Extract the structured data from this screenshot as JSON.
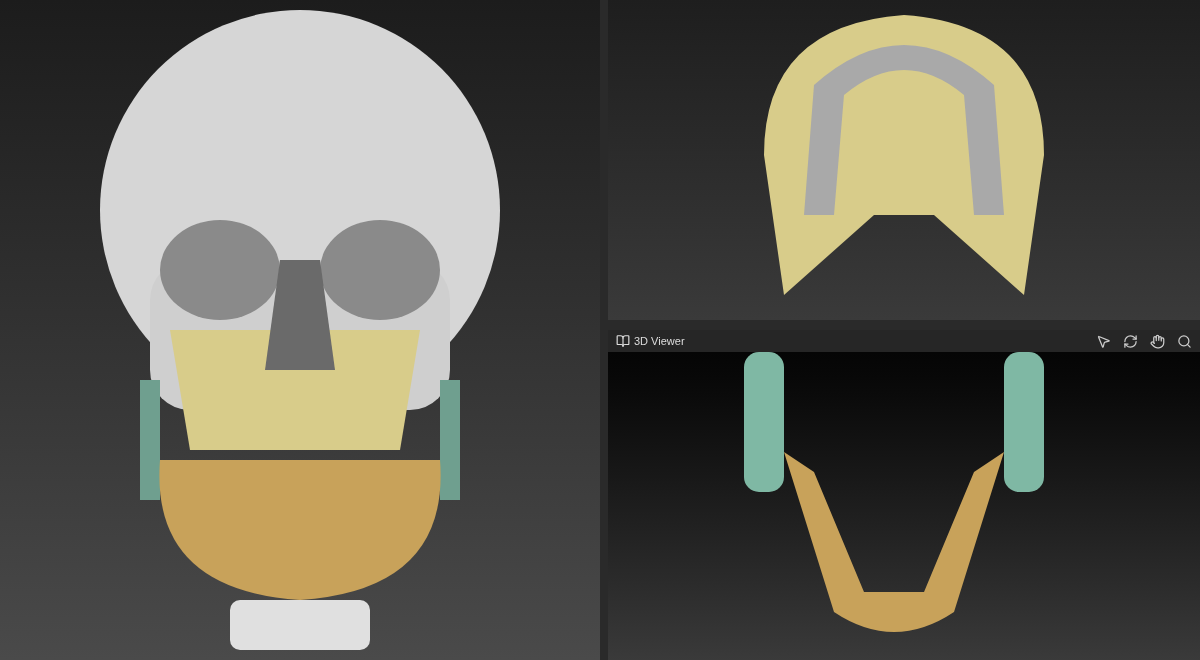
{
  "viewer_panel": {
    "title": "3D Viewer"
  }
}
